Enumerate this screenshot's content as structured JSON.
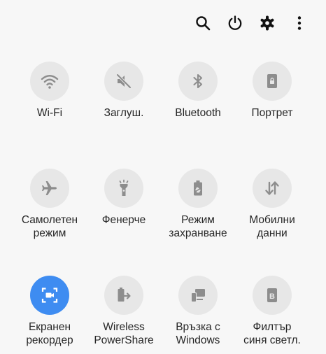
{
  "colors": {
    "background": "#f7f7f7",
    "tile_off": "#e7e7e7",
    "tile_on": "#3e8cf1",
    "icon_off": "#8d8d8d",
    "icon_on": "#ffffff",
    "label": "#262626",
    "top_icon": "#111111"
  },
  "top_bar": {
    "icons": [
      "search-icon",
      "power-icon",
      "settings-gear-icon",
      "more-vertical-icon"
    ]
  },
  "tiles": [
    {
      "label": "Wi-Fi",
      "icon": "wifi-icon",
      "active": false
    },
    {
      "label": "Заглуш.",
      "icon": "sound-muted-icon",
      "active": false
    },
    {
      "label": "Bluetooth",
      "icon": "bluetooth-icon",
      "active": false
    },
    {
      "label": "Портрет",
      "icon": "portrait-lock-icon",
      "active": false
    },
    {
      "label": "Самолетен\nрежим",
      "icon": "airplane-icon",
      "active": false
    },
    {
      "label": "Фенерче",
      "icon": "flashlight-icon",
      "active": false
    },
    {
      "label": "Режим\nзахранване",
      "icon": "power-saving-battery-icon",
      "active": false
    },
    {
      "label": "Мобилни\nданни",
      "icon": "mobile-data-arrows-icon",
      "active": false
    },
    {
      "label": "Екранен\nрекордер",
      "icon": "screen-recorder-icon",
      "active": true
    },
    {
      "label": "Wireless\nPowerShare",
      "icon": "wireless-powershare-icon",
      "active": false
    },
    {
      "label": "Връзка с\nWindows",
      "icon": "link-to-windows-icon",
      "active": false
    },
    {
      "label": "Филтър\nсиня светл.",
      "icon": "blue-light-filter-icon",
      "active": false
    }
  ]
}
